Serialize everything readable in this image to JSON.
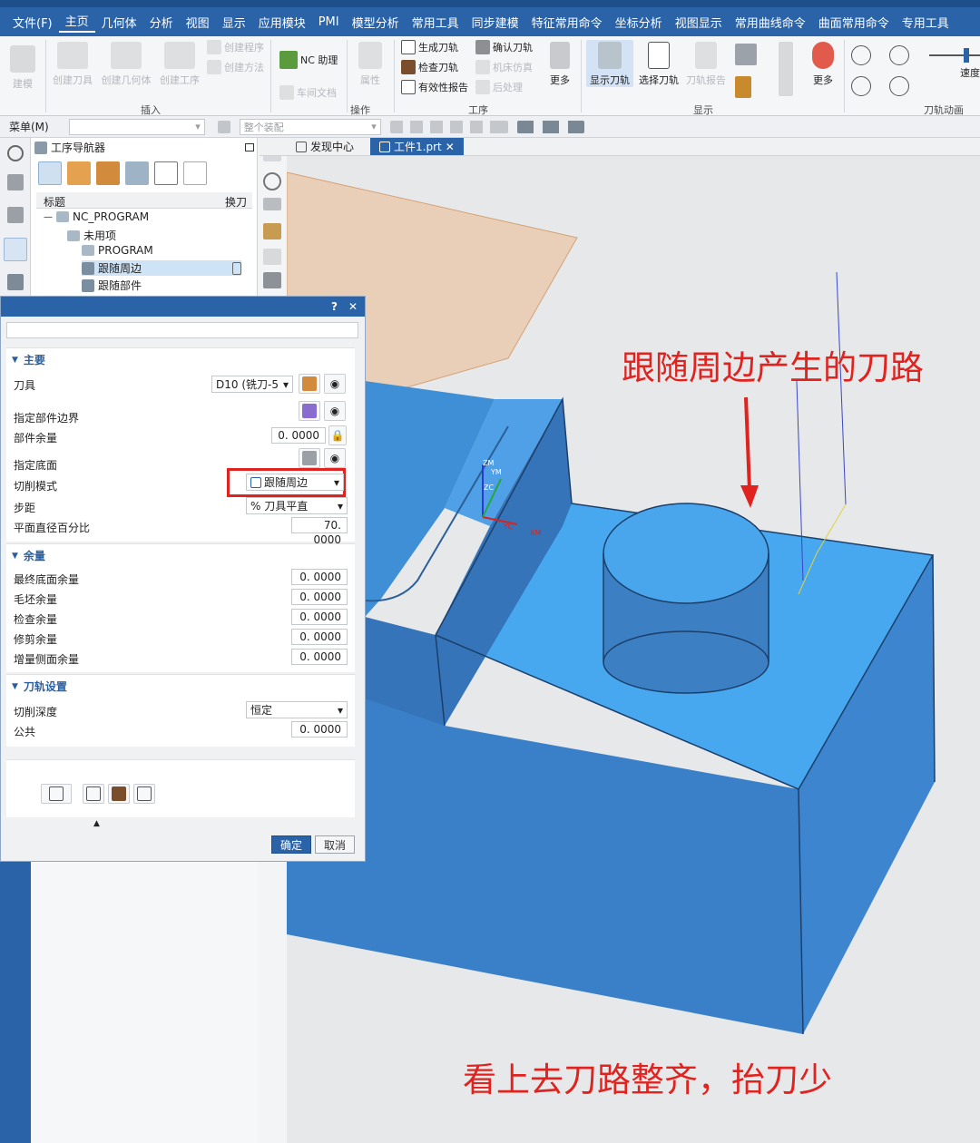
{
  "menubar": {
    "items": [
      "文件(F)",
      "主页",
      "几何体",
      "分析",
      "视图",
      "显示",
      "应用模块",
      "PMI",
      "模型分析",
      "常用工具",
      "同步建模",
      "特征常用命令",
      "坐标分析",
      "视图显示",
      "常用曲线命令",
      "曲面常用命令",
      "专用工具"
    ]
  },
  "ribbon": {
    "build": "建模",
    "create_tool": "创建刀具",
    "create_geom": "创建几何体",
    "create_op": "创建工序",
    "create_program": "创建程序",
    "create_method": "创建方法",
    "nc_assist": "NC 助理",
    "shop_doc": "车间文档",
    "attr": "属性",
    "gen_toolpath": "生成刀轨",
    "confirm_toolpath": "确认刀轨",
    "check_tool": "检查刀轨",
    "machine_sim": "机床仿真",
    "validity_report": "有效性报告",
    "post": "后处理",
    "more": "更多",
    "show_toolpath": "显示刀轨",
    "select_toolpath": "选择刀轨",
    "toolpath_report": "刀轨报告",
    "more2": "更多",
    "speed": "速度",
    "grp_insert": "插入",
    "grp_op": "操作",
    "grp_procedure": "工序",
    "grp_display": "显示",
    "grp_anim": "刀轨动画"
  },
  "quickbar": {
    "menu": "菜单(M)",
    "whole_assembly": "整个装配"
  },
  "navigator": {
    "title": "工序导航器",
    "col_title": "标题",
    "col_tool": "换刀",
    "rows": [
      {
        "label": "NC_PROGRAM"
      },
      {
        "label": "未用项"
      },
      {
        "label": "PROGRAM"
      },
      {
        "label": "跟随周边"
      },
      {
        "label": "跟随部件"
      }
    ]
  },
  "tabs": {
    "discover": "发现中心",
    "part": "工件1.prt"
  },
  "dialog": {
    "help": "?",
    "close": "✕",
    "sec_main": "主要",
    "tool_label": "刀具",
    "tool_value": "D10 (铣刀-5",
    "part_boundary": "指定部件边界",
    "part_stock_label": "部件余量",
    "part_stock_value": "0. 0000",
    "floor": "指定底面",
    "cut_mode_label": "切削模式",
    "cut_mode_value": "跟随周边",
    "stepover_label": "步距",
    "stepover_value": "% 刀具平直",
    "percent_label": "平面直径百分比",
    "percent_value": "70. 0000",
    "sec_stock": "余量",
    "final_floor_label": "最终底面余量",
    "final_floor_value": "0. 0000",
    "blank_label": "毛坯余量",
    "blank_value": "0. 0000",
    "check_label": "检查余量",
    "check_value": "0. 0000",
    "trim_label": "修剪余量",
    "trim_value": "0. 0000",
    "wall_label": "增量侧面余量",
    "wall_value": "0. 0000",
    "sec_path": "刀轨设置",
    "depth_label": "切削深度",
    "depth_value": "恒定",
    "common_label": "公共",
    "common_value": "0. 0000",
    "ok": "确定",
    "cancel": "取消"
  },
  "annotations": {
    "top": "跟随周边产生的刀路",
    "bottom": "看上去刀路整齐，抬刀少"
  },
  "colors": {
    "brand": "#2b63a8",
    "accent_red": "#e0231f",
    "part_top": "#47a8f0",
    "part_side": "#3d86cf",
    "part_front": "#3a80c8"
  },
  "axis_labels": {
    "zm": "ZM",
    "ym": "YM",
    "zc": "ZC",
    "yc": "YC",
    "xm": "XM"
  }
}
